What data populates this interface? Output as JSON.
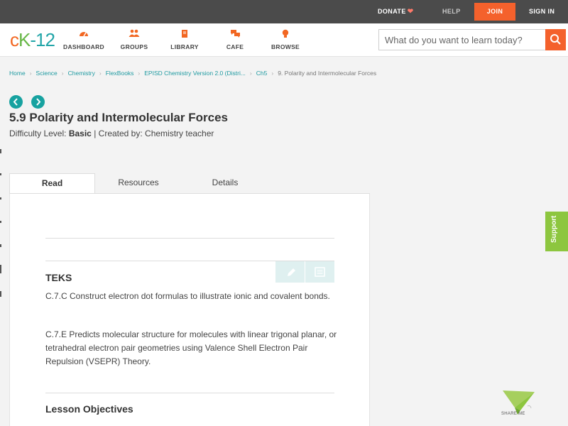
{
  "topbar": {
    "donate": "DONATE",
    "help": "HELP",
    "join": "JOIN",
    "signin": "SIGN IN"
  },
  "logo": {
    "part1": "c",
    "part2": "K",
    "part3": "-12"
  },
  "nav": {
    "dashboard": "DASHBOARD",
    "groups": "GROUPS",
    "library": "LIBRARY",
    "cafe": "CAFE",
    "browse": "BROWSE"
  },
  "search": {
    "placeholder": "What do you want to learn today?"
  },
  "breadcrumb": {
    "c0": "Home",
    "c1": "Science",
    "c2": "Chemistry",
    "c3": "FlexBooks",
    "c4": "EPISD Chemistry Version 2.0 (Distri...",
    "c5": "Ch5",
    "c6": "9. Polarity and Intermolecular Forces"
  },
  "article": {
    "title": "5.9 Polarity and Intermolecular Forces",
    "difficulty_label": "Difficulty Level:",
    "difficulty": "Basic",
    "created_by": "| Created by: Chemistry teacher"
  },
  "tabs": {
    "read": "Read",
    "resources": "Resources",
    "details": "Details"
  },
  "content": {
    "teks_heading": "TEKS",
    "teks_p1": "C.7.C Construct electron dot formulas to illustrate ionic and covalent bonds.",
    "teks_p2": "C.7.E Predicts molecular structure for molecules with linear trigonal planar, or tetrahedral electron pair geometries using Valence Shell Electron Pair Repulsion (VSEPR) Theory.",
    "objectives_heading": "Lesson Objectives"
  },
  "support": "Support",
  "share": "SHARE ME",
  "colors": {
    "accent_orange": "#f4612c",
    "teal": "#17a2a0",
    "support_green": "#8dc63f"
  }
}
